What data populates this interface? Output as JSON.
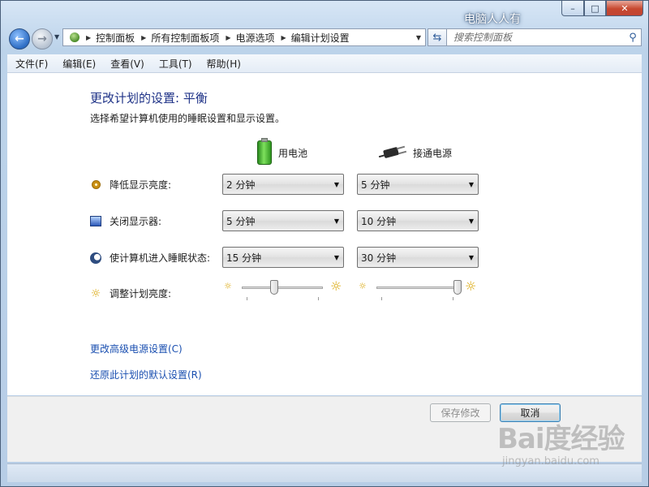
{
  "window": {
    "title": "电脑人人有",
    "caption": {
      "minimize": "–",
      "maximize": "□",
      "close": "✕"
    }
  },
  "navigation": {
    "back_icon": "back-arrow-icon",
    "forward_icon": "forward-arrow-icon",
    "breadcrumbs": [
      "控制面板",
      "所有控制面板项",
      "电源选项",
      "编辑计划设置"
    ]
  },
  "search": {
    "placeholder": "搜索控制面板"
  },
  "menubar": [
    "文件(F)",
    "编辑(E)",
    "查看(V)",
    "工具(T)",
    "帮助(H)"
  ],
  "content": {
    "title": "更改计划的设置: 平衡",
    "subtitle": "选择希望计算机使用的睡眠设置和显示设置。",
    "columns": {
      "battery": "用电池",
      "plugged_in": "接通电源"
    },
    "rows": {
      "dim_display": {
        "label": "降低显示亮度:",
        "battery": "2 分钟",
        "plugged_in": "5 分钟"
      },
      "turn_off_display": {
        "label": "关闭显示器:",
        "battery": "5 分钟",
        "plugged_in": "10 分钟"
      },
      "sleep": {
        "label": "使计算机进入睡眠状态:",
        "battery": "15 分钟",
        "plugged_in": "30 分钟"
      },
      "brightness": {
        "label": "调整计划亮度:",
        "battery_level": 0.4,
        "plugged_in_level": 1.0
      }
    },
    "links": {
      "advanced": "更改高级电源设置(C)",
      "restore": "还原此计划的默认设置(R)"
    }
  },
  "footer": {
    "save": "保存修改",
    "cancel": "取消"
  },
  "watermark": {
    "main": "Bai度经验",
    "sub": "jingyan.baidu.com"
  },
  "colors": {
    "heading": "#1e3287",
    "link": "#1a4fb0"
  }
}
